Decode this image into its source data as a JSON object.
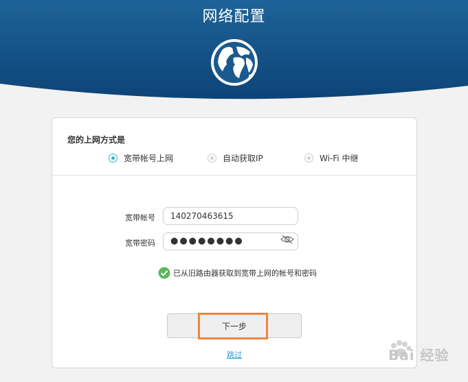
{
  "header": {
    "title": "网络配置",
    "icon": "globe-icon",
    "bg_color_top": "#1a5a8e",
    "bg_color_bottom": "#0f4a7c"
  },
  "connection": {
    "title": "您的上网方式是",
    "options": [
      {
        "label": "宽带帐号上网",
        "selected": true
      },
      {
        "label": "自动获取IP",
        "selected": false
      },
      {
        "label": "Wi-Fi 中继",
        "selected": false
      }
    ],
    "accent_color": "#31b5c8"
  },
  "form": {
    "account_label": "宽带帐号",
    "account_value": "140270463615",
    "password_label": "宽带密码",
    "password_value": "●●●●●●●●",
    "password_toggle_icon": "eye-slash-icon"
  },
  "notice": {
    "icon": "check-circle-icon",
    "text": "已从旧路由器获取到宽带上网的帐号和密码",
    "color": "#5cb85c"
  },
  "actions": {
    "next_label": "下一步",
    "skip_label": "跳过",
    "highlight_color": "#f0843c"
  },
  "watermark": {
    "text": "Bai 经验"
  }
}
